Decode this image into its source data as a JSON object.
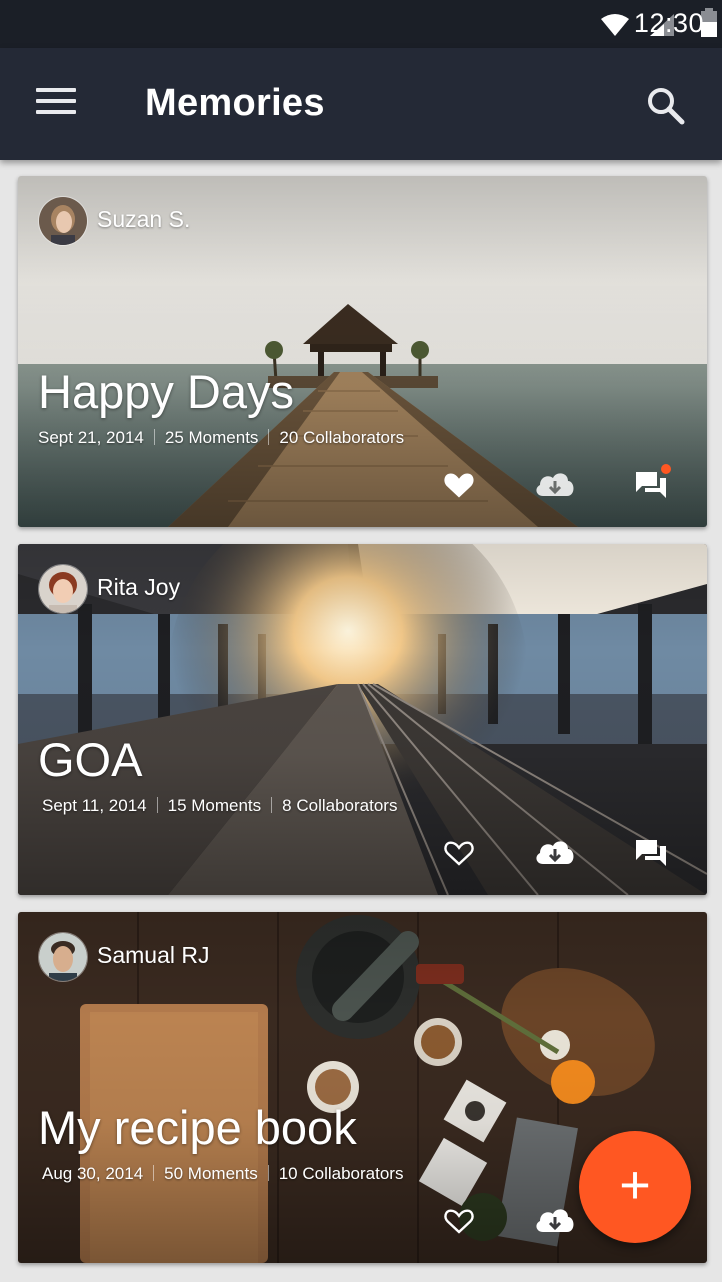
{
  "status_bar": {
    "time": "12:30",
    "icons": [
      "wifi-icon",
      "signal-icon",
      "battery-icon"
    ]
  },
  "app_bar": {
    "title": "Memories",
    "menu_icon": "hamburger-menu-icon",
    "search_icon": "search-icon"
  },
  "cards": [
    {
      "author": "Suzan S.",
      "title": "Happy Days",
      "date": "Sept 21, 2014",
      "moments": "25 Moments",
      "collaborators": "20 Collaborators",
      "liked": true,
      "has_new_comments": true
    },
    {
      "author": "Rita Joy",
      "title": "GOA",
      "date": "Sept 11, 2014",
      "moments": "15 Moments",
      "collaborators": "8 Collaborators",
      "liked": false,
      "has_new_comments": false
    },
    {
      "author": "Samual RJ",
      "title": "My recipe book",
      "date": "Aug 30, 2014",
      "moments": "50 Moments",
      "collaborators": "10 Collaborators",
      "liked": false,
      "has_new_comments": false
    }
  ],
  "fab": {
    "label": "+",
    "icon": "add-icon"
  },
  "colors": {
    "accent": "#ff5722",
    "app_bar": "#242936",
    "status_bar": "#1b1f27",
    "background": "#e6e6e6"
  }
}
